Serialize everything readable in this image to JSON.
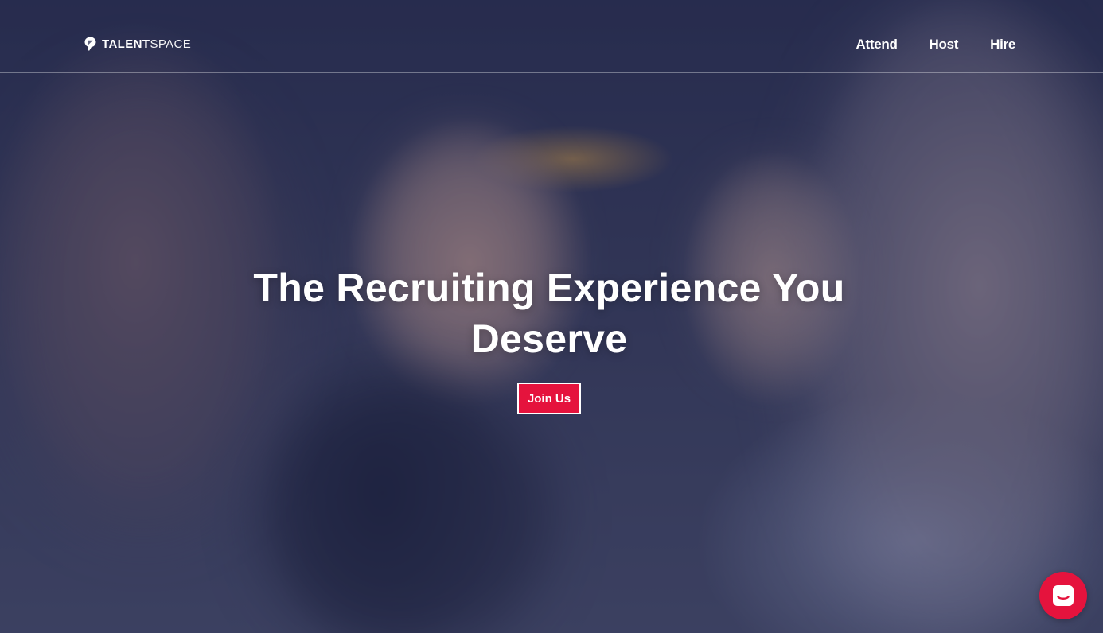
{
  "brand": {
    "name_bold": "TALENT",
    "name_light": "SPACE",
    "logo_icon": "talentspace-logo-icon"
  },
  "nav": {
    "items": [
      {
        "label": "Attend"
      },
      {
        "label": "Host"
      },
      {
        "label": "Hire"
      }
    ]
  },
  "hero": {
    "headline": "The Recruiting Experience You Deserve",
    "cta_label": "Join Us",
    "background": "photo of people talking at a recruiting event"
  },
  "chat_widget": {
    "icon": "chat-icon"
  },
  "colors": {
    "accent": "#e5133d",
    "overlay": "#24284e",
    "text": "#ffffff"
  }
}
